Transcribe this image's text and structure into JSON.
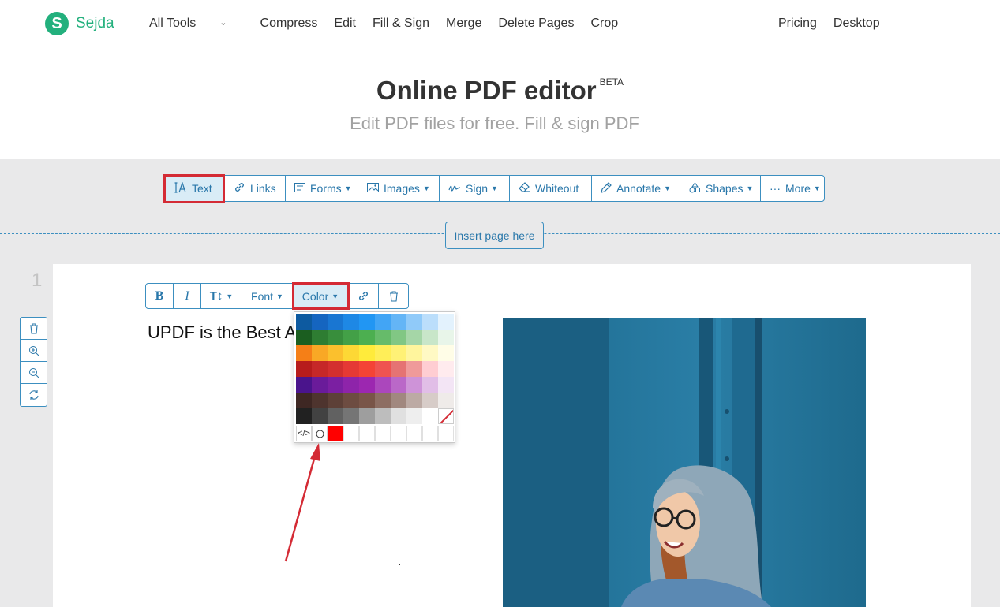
{
  "brand": {
    "logo_letter": "S",
    "name": "Sejda",
    "accent": "#23b07d"
  },
  "nav": {
    "items": [
      "All Tools",
      "Compress",
      "Edit",
      "Fill & Sign",
      "Merge",
      "Delete Pages",
      "Crop"
    ],
    "right": [
      "Pricing",
      "Desktop"
    ]
  },
  "hero": {
    "title": "Online PDF editor",
    "badge": "BETA",
    "subtitle": "Edit PDF files for free. Fill & sign PDF"
  },
  "toolbar": {
    "text": "Text",
    "links": "Links",
    "forms": "Forms",
    "images": "Images",
    "sign": "Sign",
    "whiteout": "Whiteout",
    "annotate": "Annotate",
    "shapes": "Shapes",
    "more": "More"
  },
  "insert_page": "Insert page here",
  "page": {
    "number": "1",
    "text": "UPDF is the Best A"
  },
  "text_toolbar": {
    "bold": "B",
    "italic": "I",
    "size": "T↕",
    "font": "Font",
    "color": "Color"
  },
  "colors": {
    "primary": "#2977aa",
    "highlight": "#d42b35",
    "selected": "#ff0000",
    "palette": [
      [
        "#0d5aa0",
        "#1565c0",
        "#1976d2",
        "#1e88e5",
        "#2196f3",
        "#42a5f5",
        "#64b5f6",
        "#90caf9",
        "#bbdefb",
        "#e3f2fd"
      ],
      [
        "#1b5e20",
        "#2e7d32",
        "#388e3c",
        "#43a047",
        "#4caf50",
        "#66bb6a",
        "#81c784",
        "#a5d6a7",
        "#c8e6c9",
        "#e8f5e9"
      ],
      [
        "#f57f17",
        "#f9a825",
        "#fbc02d",
        "#fdd835",
        "#ffeb3b",
        "#ffee58",
        "#fff176",
        "#fff59d",
        "#fff9c4",
        "#fffde7"
      ],
      [
        "#b71c1c",
        "#c62828",
        "#d32f2f",
        "#e53935",
        "#f44336",
        "#ef5350",
        "#e57373",
        "#ef9a9a",
        "#ffcdd2",
        "#ffebee"
      ],
      [
        "#4a148c",
        "#6a1b9a",
        "#7b1fa2",
        "#8e24aa",
        "#9c27b0",
        "#ab47bc",
        "#ba68c8",
        "#ce93d8",
        "#e1bee7",
        "#f3e5f5"
      ],
      [
        "#3e2723",
        "#4e342e",
        "#5d4037",
        "#6d4c41",
        "#795548",
        "#8d6e63",
        "#a1887f",
        "#bcaaa4",
        "#d7ccc8",
        "#efebe9"
      ],
      [
        "#212121",
        "#424242",
        "#616161",
        "#757575",
        "#9e9e9e",
        "#bdbdbd",
        "#e0e0e0",
        "#eeeeee",
        "#ffffff",
        "none"
      ]
    ]
  },
  "icons": {
    "text": "text-cursor-icon",
    "links": "link-icon",
    "forms": "form-icon",
    "images": "image-icon",
    "sign": "signature-icon",
    "whiteout": "eraser-icon",
    "annotate": "pen-icon",
    "shapes": "shapes-icon",
    "more": "ellipsis-icon",
    "delete": "trash-icon",
    "zoom_in": "zoom-in-icon",
    "zoom_out": "zoom-out-icon",
    "rotate": "rotate-icon",
    "code": "code-icon",
    "eyedropper": "crosshair-icon"
  }
}
